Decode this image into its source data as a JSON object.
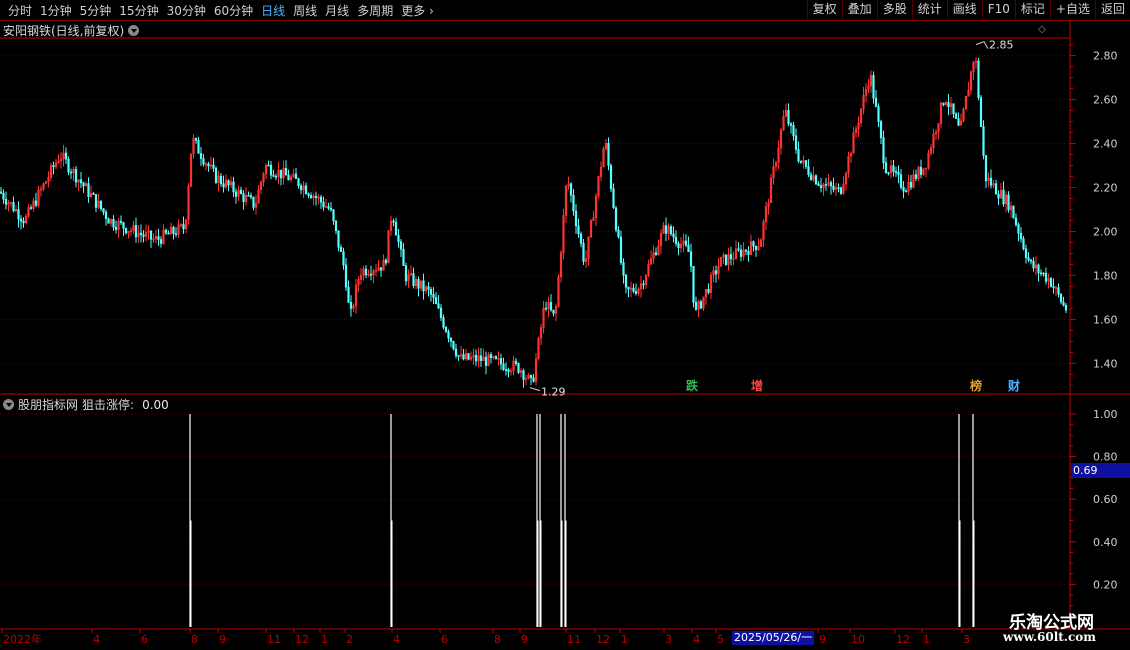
{
  "toolbar": {
    "periods": [
      "分时",
      "1分钟",
      "5分钟",
      "15分钟",
      "30分钟",
      "60分钟",
      "日线",
      "周线",
      "月线",
      "多周期",
      "更多"
    ],
    "active": "日线",
    "buttons": [
      "复权",
      "叠加",
      "多股",
      "统计",
      "画线",
      "F10",
      "标记",
      "+自选",
      "返回"
    ]
  },
  "main": {
    "title": "安阳钢铁(日线,前复权)",
    "high_label": "2.85",
    "low_label": "1.29",
    "y_ticks": [
      "2.80",
      "2.60",
      "2.40",
      "2.20",
      "2.00",
      "1.80",
      "1.60",
      "1.40"
    ],
    "markers": [
      {
        "text": "跌",
        "color": "#2fbf4f"
      },
      {
        "text": "增",
        "color": "#ff4040"
      },
      {
        "text": "榜",
        "color": "#e0a030"
      },
      {
        "text": "财",
        "color": "#4fb4ff"
      }
    ]
  },
  "indicator": {
    "name": "股朋指标网",
    "label": "狙击涨停:",
    "value": "0.00",
    "y_ticks": [
      "1.00",
      "0.80",
      "0.60",
      "0.40",
      "0.20"
    ],
    "current": "0.69"
  },
  "xaxis": {
    "labels": [
      "2022年",
      "4",
      "6",
      "8",
      "9",
      "11",
      "12",
      "1",
      "2",
      "4",
      "6",
      "8",
      "9",
      "11",
      "12",
      "1",
      "3",
      "4",
      "5",
      "9",
      "10",
      "12",
      "1",
      "3"
    ],
    "selected_date": "2025/05/26/一"
  },
  "watermark": {
    "line1": "乐淘公式网",
    "line2": "www.60lt.com"
  },
  "colors": {
    "up": "#ff3232",
    "down": "#54ffff",
    "axis": "#c00000",
    "grid": "#5a0000"
  }
}
